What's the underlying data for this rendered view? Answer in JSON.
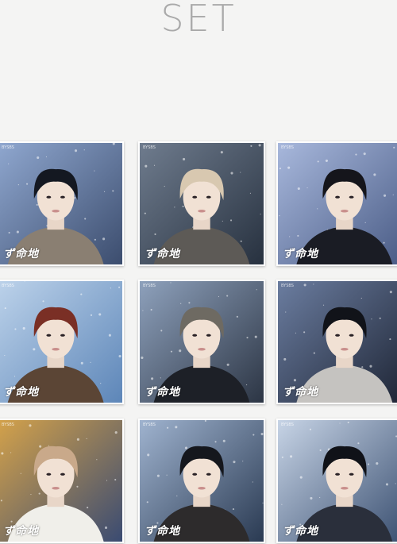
{
  "header": {
    "title": "SET"
  },
  "photocards": [
    {
      "member": "card-1",
      "logo": "ず命地",
      "brand": "BYSBS",
      "bg": "#3c4d6e",
      "accent": "#8fa7cf",
      "hair": "#141821",
      "coat": "#8a7f72"
    },
    {
      "member": "card-2",
      "logo": "ず命地",
      "brand": "BYSBS",
      "bg": "#27313f",
      "accent": "#6f7c8e",
      "hair": "#d8c8b0",
      "coat": "#5d5a56"
    },
    {
      "member": "card-3",
      "logo": "ず命地",
      "brand": "BYSBS",
      "bg": "#4a5c86",
      "accent": "#a8b8dc",
      "hair": "#15151b",
      "coat": "#1a1c24"
    },
    {
      "member": "card-4",
      "logo": "ず命地",
      "brand": "BYSBS",
      "bg": "#5d86b8",
      "accent": "#bcd2ea",
      "hair": "#7a2f25",
      "coat": "#5b4535"
    },
    {
      "member": "card-5",
      "logo": "ず命地",
      "brand": "BYSBS",
      "bg": "#2c3544",
      "accent": "#8ea1bc",
      "hair": "#6e6a62",
      "coat": "#1d2027"
    },
    {
      "member": "card-6",
      "logo": "ず命地",
      "brand": "BYSBS",
      "bg": "#1f2636",
      "accent": "#6b7da0",
      "hair": "#111319",
      "coat": "#c5c3c0"
    },
    {
      "member": "card-7",
      "logo": "ず命地",
      "brand": "BYSBS",
      "bg": "#3a4b72",
      "accent": "#d4a24a",
      "hair": "#c9a98a",
      "coat": "#f0efea"
    },
    {
      "member": "card-8",
      "logo": "ず命地",
      "brand": "BYSBS",
      "bg": "#2a3a52",
      "accent": "#9fb3cf",
      "hair": "#15171d",
      "coat": "#2d2b2c"
    },
    {
      "member": "card-9",
      "logo": "ず命地",
      "brand": "BYSBS",
      "bg": "#3c5172",
      "accent": "#c7d4e6",
      "hair": "#101218",
      "coat": "#2a2f3b"
    }
  ]
}
